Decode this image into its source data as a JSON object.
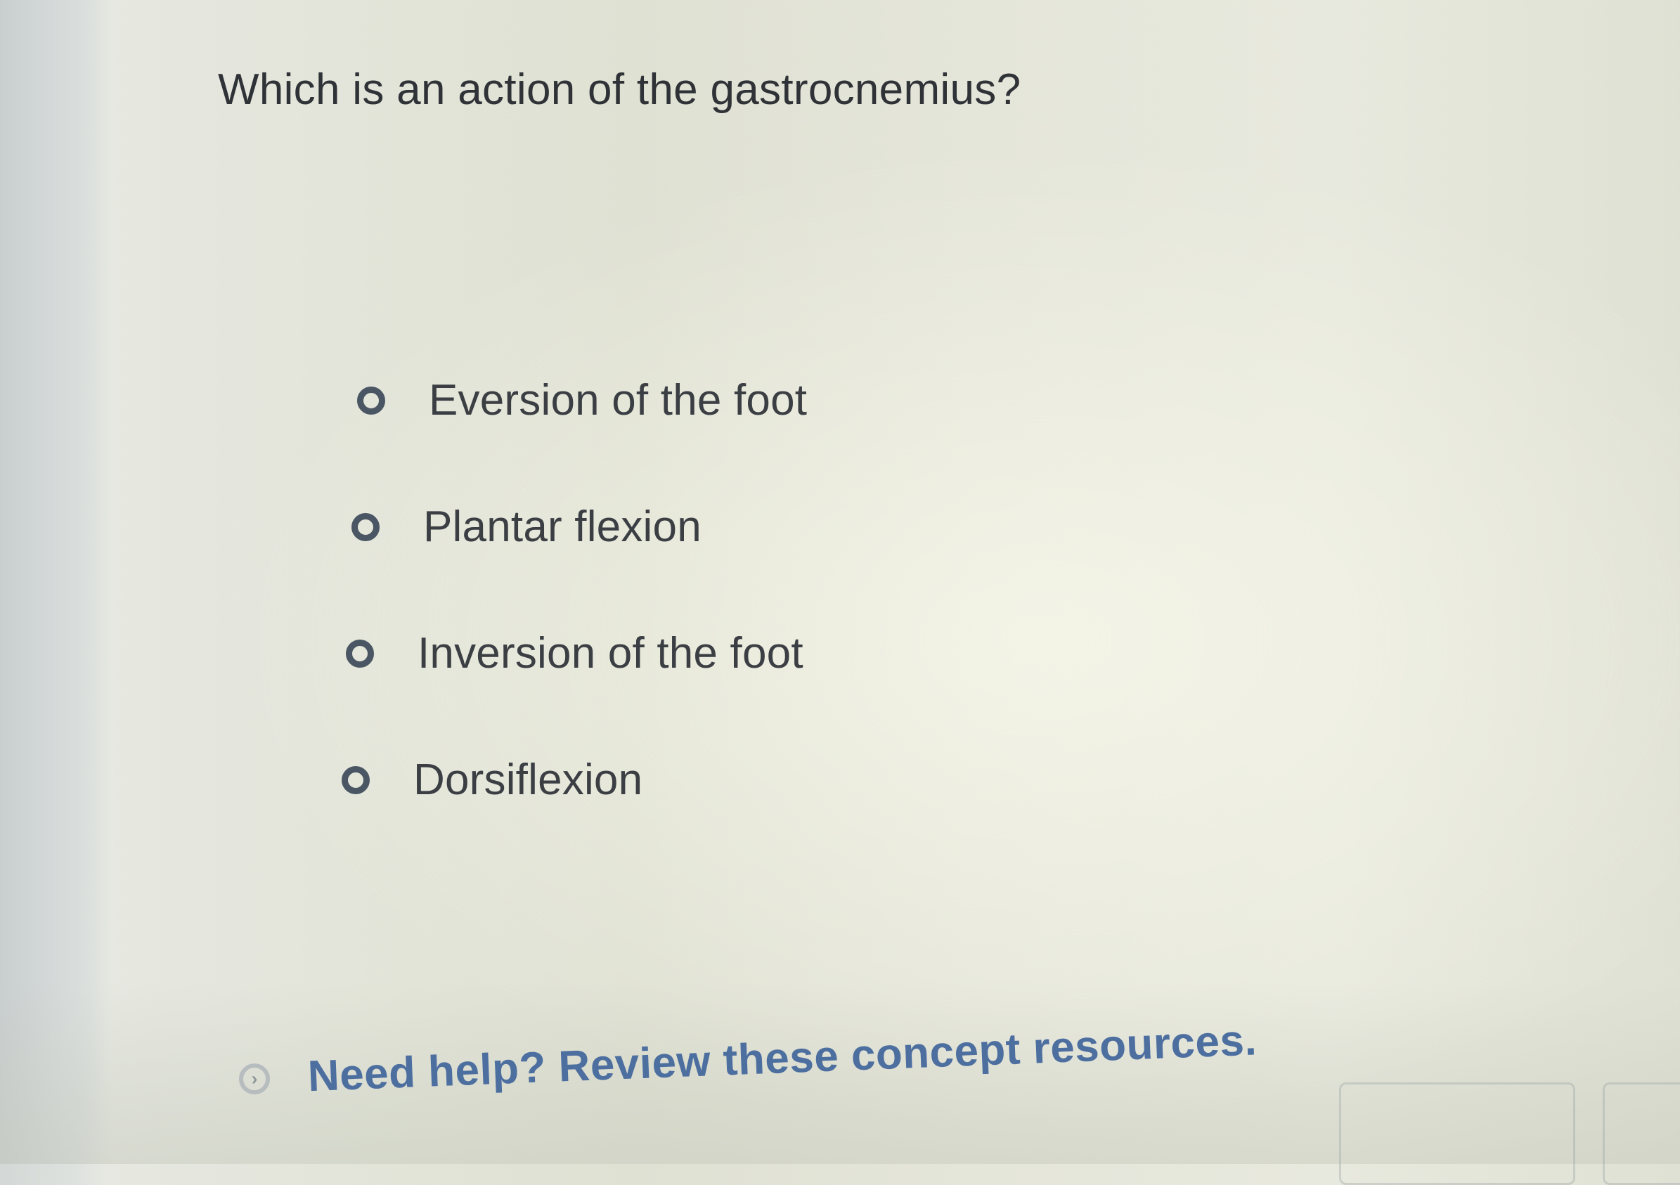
{
  "question": {
    "text": "Which is an action of the gastrocnemius?"
  },
  "options": [
    {
      "label": "Eversion of the foot",
      "selected": false
    },
    {
      "label": "Plantar flexion",
      "selected": false
    },
    {
      "label": "Inversion of the foot",
      "selected": false
    },
    {
      "label": "Dorsiflexion",
      "selected": false
    }
  ],
  "help": {
    "icon": "chevron-right-icon",
    "link_text": "Need help? Review these concept resources."
  },
  "colors": {
    "text": "#3b3f44",
    "radio": "#4a5663",
    "link": "#4d6fa0"
  }
}
